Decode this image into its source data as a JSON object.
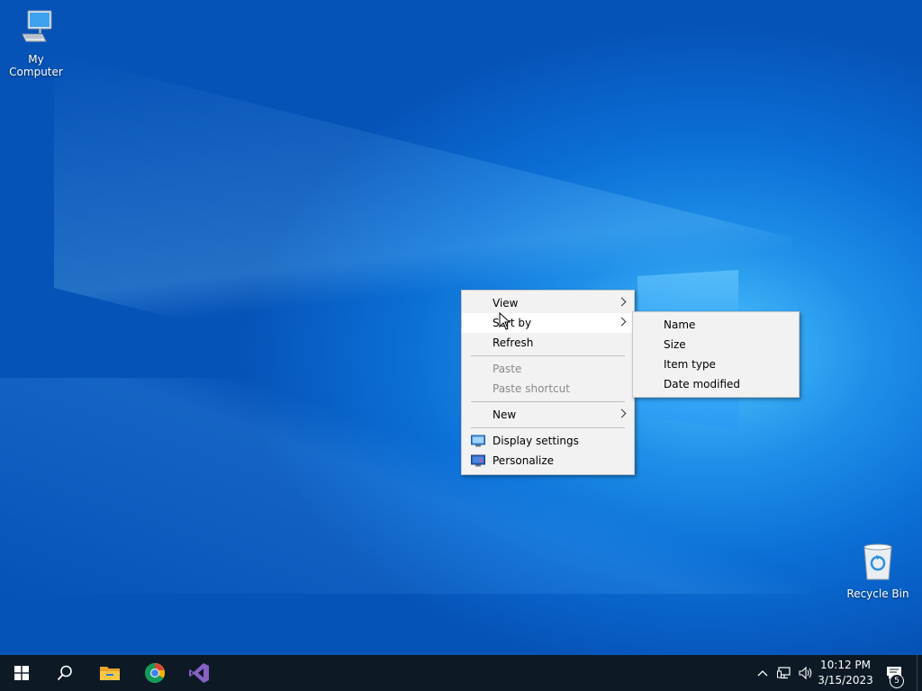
{
  "desktop": {
    "icons": [
      {
        "label": "My Computer",
        "icon": "computer-icon"
      },
      {
        "label": "Recycle Bin",
        "icon": "recycle-bin-icon"
      }
    ]
  },
  "context_menu": {
    "items": [
      {
        "label": "View",
        "has_submenu": true
      },
      {
        "label": "Sort by",
        "has_submenu": true,
        "highlighted": true
      },
      {
        "label": "Refresh"
      },
      {
        "label": "Paste",
        "disabled": true
      },
      {
        "label": "Paste shortcut",
        "disabled": true
      },
      {
        "label": "New",
        "has_submenu": true
      },
      {
        "label": "Display settings",
        "icon": "display-icon"
      },
      {
        "label": "Personalize",
        "icon": "personalize-icon"
      }
    ]
  },
  "sort_by_submenu": {
    "items": [
      {
        "label": "Name"
      },
      {
        "label": "Size"
      },
      {
        "label": "Item type"
      },
      {
        "label": "Date modified"
      }
    ]
  },
  "taskbar": {
    "apps": [
      "start-icon",
      "search-icon",
      "file-explorer-icon",
      "chrome-icon",
      "visual-studio-icon"
    ],
    "clock": {
      "time": "10:12 PM",
      "date": "3/15/2023"
    },
    "notification_count": "5",
    "colors": {
      "background": "#0d1a26",
      "desktop_blue": "#0b6fd6"
    }
  }
}
